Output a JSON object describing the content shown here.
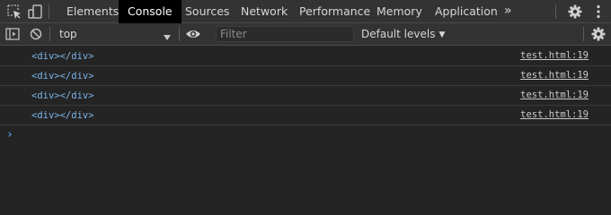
{
  "tabs": [
    {
      "label": "Elements",
      "active": false
    },
    {
      "label": "Console",
      "active": true
    },
    {
      "label": "Sources",
      "active": false
    },
    {
      "label": "Network",
      "active": false
    },
    {
      "label": "Performance",
      "active": false
    },
    {
      "label": "Memory",
      "active": false
    },
    {
      "label": "Application",
      "active": false
    }
  ],
  "more_tabs_label": "»",
  "toolbar": {
    "context": "top",
    "filter_placeholder": "Filter",
    "levels_label": "Default levels"
  },
  "messages": [
    {
      "text": "<div></div>",
      "source": "test.html:19"
    },
    {
      "text": "<div></div>",
      "source": "test.html:19"
    },
    {
      "text": "<div></div>",
      "source": "test.html:19"
    },
    {
      "text": "<div></div>",
      "source": "test.html:19"
    }
  ],
  "prompt_symbol": "›",
  "colors": {
    "panel_bg": "#242424",
    "toolbar_bg": "#333333",
    "active_tab_bg": "#000000",
    "element_tag": "#7ab3e8",
    "prompt": "#4a93e0"
  },
  "icons": [
    "inspect-element-icon",
    "device-toolbar-icon",
    "settings-gear-icon",
    "kebab-menu-icon",
    "sidebar-toggle-icon",
    "clear-console-icon",
    "eye-icon",
    "console-settings-gear-icon"
  ]
}
